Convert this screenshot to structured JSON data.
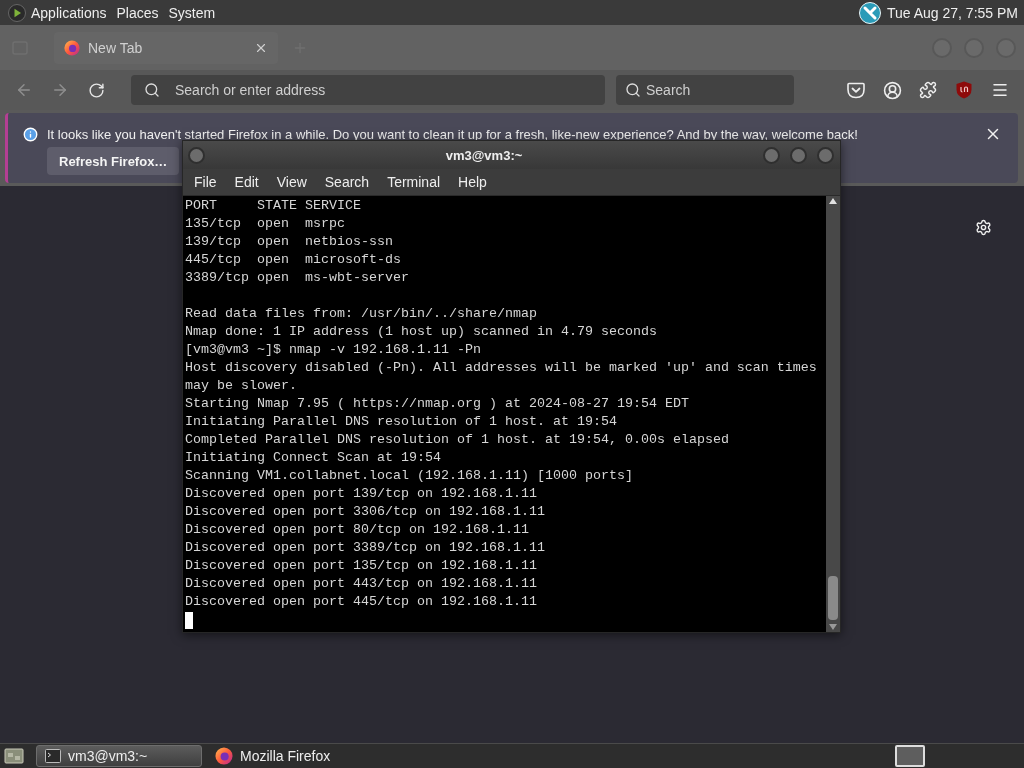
{
  "top_panel": {
    "menus": [
      "Applications",
      "Places",
      "System"
    ],
    "clock": "Tue Aug 27, 7:55 PM"
  },
  "browser": {
    "tabs": [
      {
        "label": "New Tab",
        "selected": true
      }
    ],
    "address_bar": {
      "placeholder": "Search or enter address"
    },
    "search_bar": {
      "placeholder": "Search"
    },
    "notification": {
      "message": "It looks like you haven't started Firefox in a while. Do you want to clean it up for a fresh, like-new experience? And by the way, welcome back!",
      "button": "Refresh Firefox…"
    }
  },
  "terminal": {
    "title": "vm3@vm3:~",
    "menus": [
      "File",
      "Edit",
      "View",
      "Search",
      "Terminal",
      "Help"
    ],
    "output_blocks": [
      [
        "PORT     STATE SERVICE",
        "135/tcp  open  msrpc",
        "139/tcp  open  netbios-ssn",
        "445/tcp  open  microsoft-ds",
        "3389/tcp open  ms-wbt-server"
      ],
      [
        "Read data files from: /usr/bin/../share/nmap",
        "Nmap done: 1 IP address (1 host up) scanned in 4.79 seconds",
        "[vm3@vm3 ~]$ nmap -v 192.168.1.11 -Pn",
        "Host discovery disabled (-Pn). All addresses will be marked 'up' and scan times",
        "may be slower.",
        "Starting Nmap 7.95 ( https://nmap.org ) at 2024-08-27 19:54 EDT",
        "Initiating Parallel DNS resolution of 1 host. at 19:54",
        "Completed Parallel DNS resolution of 1 host. at 19:54, 0.00s elapsed",
        "Initiating Connect Scan at 19:54",
        "Scanning VM1.collabnet.local (192.168.1.11) [1000 ports]",
        "Discovered open port 139/tcp on 192.168.1.11",
        "Discovered open port 3306/tcp on 192.168.1.11",
        "Discovered open port 80/tcp on 192.168.1.11",
        "Discovered open port 3389/tcp on 192.168.1.11",
        "Discovered open port 135/tcp on 192.168.1.11",
        "Discovered open port 443/tcp on 192.168.1.11",
        "Discovered open port 445/tcp on 192.168.1.11"
      ]
    ]
  },
  "taskbar": {
    "tasks": [
      {
        "kind": "terminal",
        "label": "vm3@vm3:~",
        "selected": true
      },
      {
        "kind": "browser",
        "label": "Mozilla Firefox",
        "selected": false
      }
    ]
  }
}
